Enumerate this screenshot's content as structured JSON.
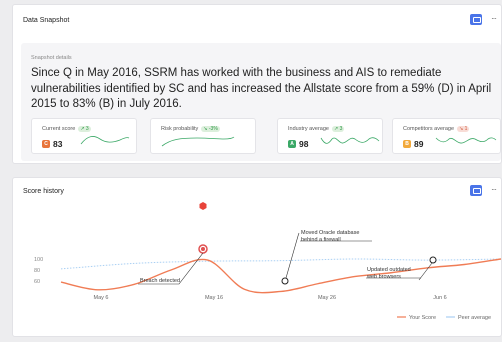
{
  "snapshot": {
    "title": "Data Snapshot",
    "more": "···",
    "details_label": "Snapshot details",
    "summary": "Since Q in May 2016, SSRM has worked with the business and AIS to remediate vulnerabilities identified by SC and has increased the Allstate score from a 59% (D) in April 2015 to 83% (B) in July 2016.",
    "cards": [
      {
        "title": "Current score",
        "delta": "3",
        "delta_dir": "up",
        "grade": "C",
        "grade_color": "#e8743b",
        "value": "83"
      },
      {
        "title": "Risk probability",
        "delta": "-3%",
        "delta_dir": "up",
        "grade": "",
        "grade_color": "",
        "value": ""
      },
      {
        "title": "Industry average",
        "delta": "3",
        "delta_dir": "up",
        "grade": "A",
        "grade_color": "#3aa866",
        "value": "98"
      },
      {
        "title": "Competitors average",
        "delta": "1",
        "delta_dir": "down",
        "grade": "B",
        "grade_color": "#f2a93b",
        "value": "89"
      }
    ]
  },
  "history": {
    "title": "Score history",
    "more": "···",
    "chart_data": {
      "type": "line",
      "x_ticks": [
        "May 6",
        "May 16",
        "May 26",
        "Jun 6"
      ],
      "y_ticks": [
        "100",
        "80",
        "60"
      ],
      "series": [
        {
          "name": "Your Score",
          "color": "#f07c55",
          "values": [
            [
              0,
              58
            ],
            [
              5,
              44
            ],
            [
              10,
              54
            ],
            [
              15,
              80
            ],
            [
              20,
              98
            ],
            [
              25,
              45
            ],
            [
              30,
              41
            ],
            [
              35,
              55
            ],
            [
              40,
              68
            ],
            [
              45,
              75
            ],
            [
              50,
              84
            ],
            [
              55,
              90
            ],
            [
              60,
              100
            ]
          ]
        },
        {
          "name": "Peer average",
          "color": "#a9cff3",
          "values": [
            [
              0,
              82
            ],
            [
              10,
              92
            ],
            [
              20,
              96
            ],
            [
              30,
              97
            ],
            [
              40,
              100
            ],
            [
              50,
              98
            ],
            [
              60,
              100
            ]
          ]
        }
      ],
      "annotations": [
        {
          "text": "Breach detected"
        },
        {
          "text": [
            "Moved Oracle database",
            "behind a firewall"
          ]
        },
        {
          "text": [
            "Updated outdated",
            "web browsers"
          ]
        }
      ],
      "legend": "bottom-right",
      "grid": false
    }
  }
}
